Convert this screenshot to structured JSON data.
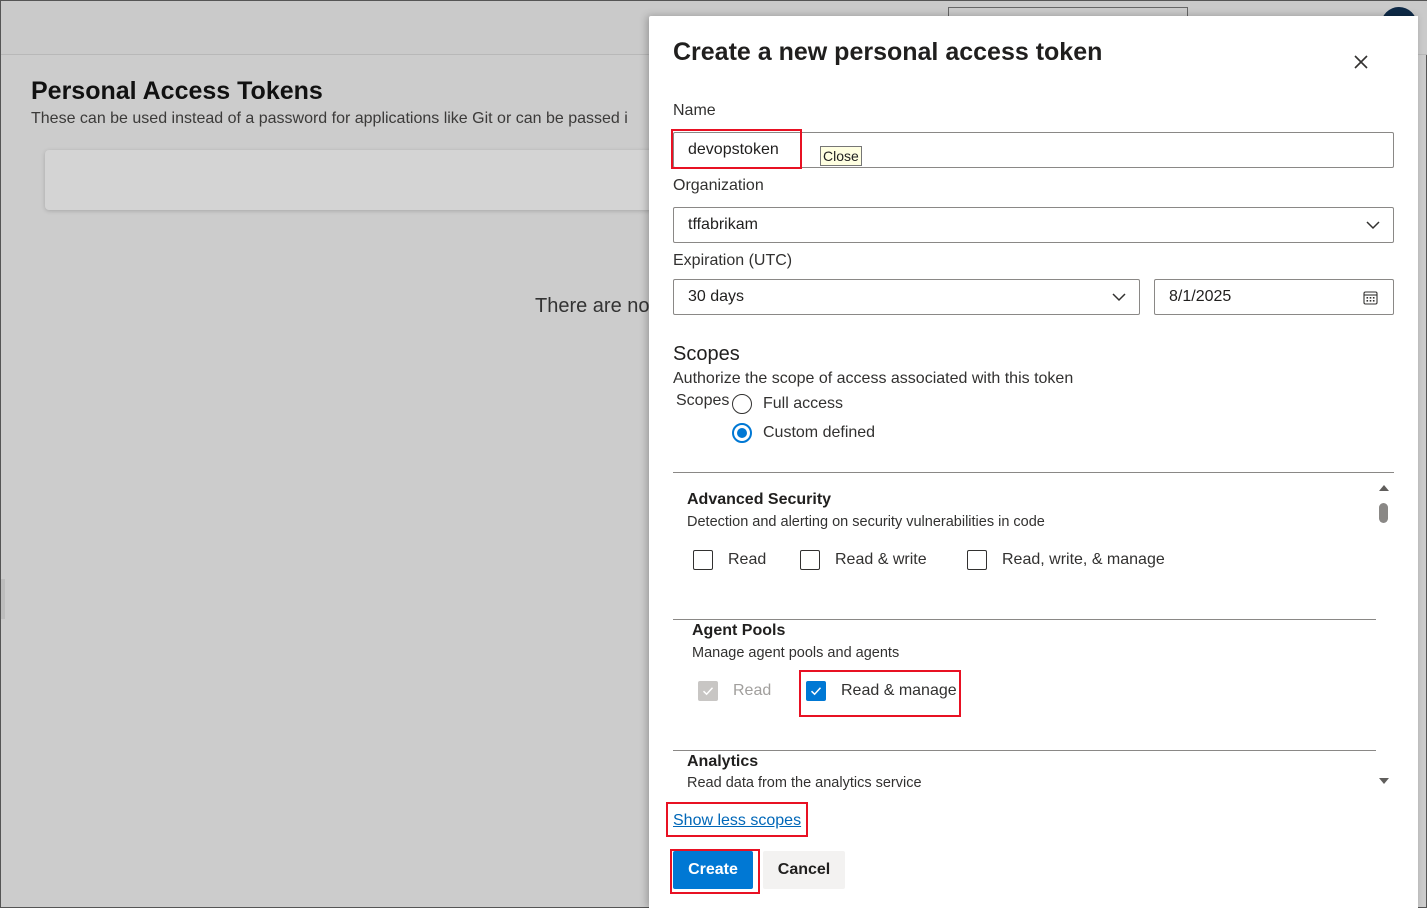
{
  "background": {
    "page_title": "Personal Access Tokens",
    "page_subtitle": "These can be used instead of a password for applications like Git or can be passed i",
    "empty_state_text": "There are no"
  },
  "panel": {
    "title": "Create a new personal access token",
    "close_tooltip": "Close",
    "name": {
      "label": "Name",
      "value": "devopstoken"
    },
    "organization": {
      "label": "Organization",
      "selected": "tffabrikam"
    },
    "expiration": {
      "label": "Expiration (UTC)",
      "selected": "30 days",
      "date": "8/1/2025"
    },
    "scopes": {
      "heading": "Scopes",
      "description": "Authorize the scope of access associated with this token",
      "group_label": "Scopes",
      "options": [
        {
          "label": "Full access",
          "checked": false
        },
        {
          "label": "Custom defined",
          "checked": true
        }
      ],
      "items": [
        {
          "title": "Advanced Security",
          "description": "Detection and alerting on security vulnerabilities in code",
          "permissions": [
            {
              "label": "Read",
              "checked": false,
              "disabled": false
            },
            {
              "label": "Read & write",
              "checked": false,
              "disabled": false
            },
            {
              "label": "Read, write, & manage",
              "checked": false,
              "disabled": false
            }
          ]
        },
        {
          "title": "Agent Pools",
          "description": "Manage agent pools and agents",
          "permissions": [
            {
              "label": "Read",
              "checked": true,
              "disabled": true
            },
            {
              "label": "Read & manage",
              "checked": true,
              "disabled": false
            }
          ]
        },
        {
          "title": "Analytics",
          "description": "Read data from the analytics service"
        }
      ]
    },
    "show_scopes_link": "Show less scopes",
    "create_button": "Create",
    "cancel_button": "Cancel"
  },
  "colors": {
    "accent": "#0078d4",
    "highlight": "#e81123",
    "link": "#0067b8"
  }
}
